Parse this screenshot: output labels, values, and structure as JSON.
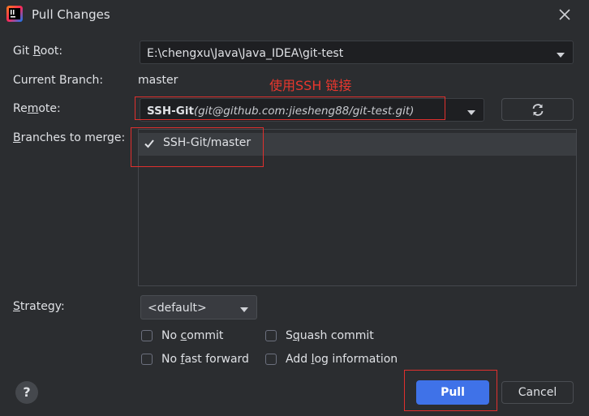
{
  "window": {
    "title": "Pull Changes"
  },
  "fields": {
    "git_root_label_pre": "Git ",
    "git_root_label_u": "R",
    "git_root_label_post": "oot:",
    "git_root_value": "E:\\chengxu\\Java\\Java_IDEA\\git-test",
    "current_branch_label": "Current Branch:",
    "current_branch_value": "master",
    "remote_label_pre": "Re",
    "remote_label_u": "m",
    "remote_label_post": "ote:",
    "remote_name": "SSH-Git",
    "remote_url": "(git@github.com:jiesheng88/git-test.git)",
    "branches_label_u": "B",
    "branches_label_post": "ranches to merge:",
    "strategy_label_u": "S",
    "strategy_label_post": "trategy:",
    "strategy_value": "<default>"
  },
  "annotation": {
    "text": "使用SSH 链接"
  },
  "branches": [
    {
      "name": "SSH-Git/master",
      "checked": true
    }
  ],
  "options": {
    "no_commit_pre": "No ",
    "no_commit_u": "c",
    "no_commit_post": "ommit",
    "squash_pre": "S",
    "squash_u": "q",
    "squash_post": "uash commit",
    "no_ff_pre": "No ",
    "no_ff_u": "f",
    "no_ff_post": "ast forward",
    "add_log_pre": "Add ",
    "add_log_u": "l",
    "add_log_post": "og information"
  },
  "buttons": {
    "help": "?",
    "pull": "Pull",
    "cancel": "Cancel"
  },
  "colors": {
    "accent": "#3f72e8",
    "annotation": "#e8372e",
    "background": "#2b2d30"
  }
}
